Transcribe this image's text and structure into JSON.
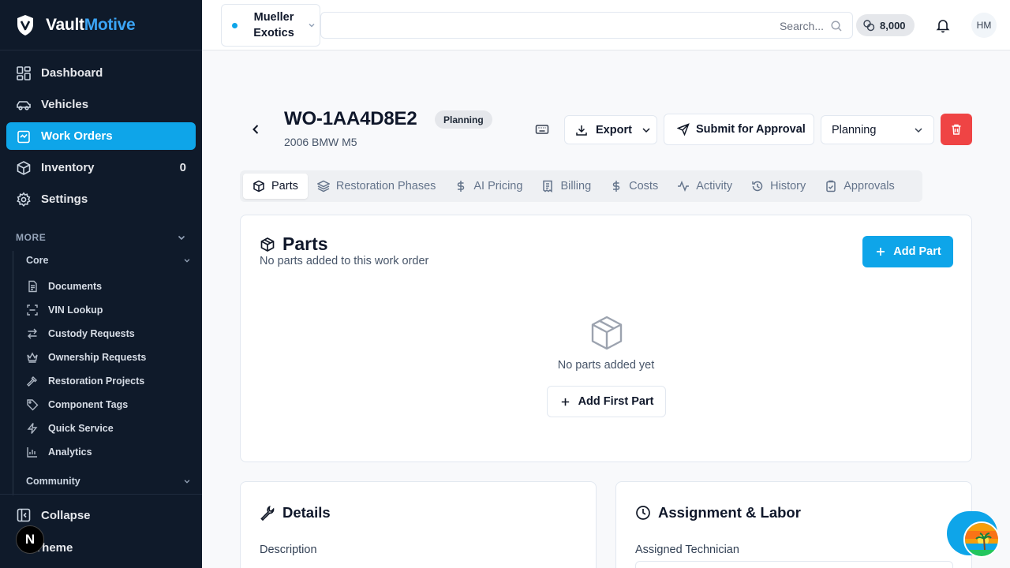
{
  "brand": {
    "name_part1": "Vault",
    "name_part2": "Motive"
  },
  "sidebar": {
    "nav": [
      {
        "label": "Dashboard",
        "icon": "dashboard-icon"
      },
      {
        "label": "Vehicles",
        "icon": "car-icon"
      },
      {
        "label": "Work Orders",
        "icon": "clipboard-icon",
        "active": true
      },
      {
        "label": "Inventory",
        "icon": "box-icon",
        "count": "0"
      },
      {
        "label": "Settings",
        "icon": "gear-icon"
      }
    ],
    "more_label": "MORE",
    "core_label": "Core",
    "core_items": [
      {
        "label": "Documents",
        "icon": "document-icon"
      },
      {
        "label": "VIN Lookup",
        "icon": "scan-icon"
      },
      {
        "label": "Custody Requests",
        "icon": "arrows-swap-icon"
      },
      {
        "label": "Ownership Requests",
        "icon": "crown-icon"
      },
      {
        "label": "Restoration Projects",
        "icon": "hammer-icon"
      },
      {
        "label": "Component Tags",
        "icon": "tag-icon"
      },
      {
        "label": "Quick Service",
        "icon": "lightning-icon"
      },
      {
        "label": "Analytics",
        "icon": "bar-chart-icon"
      }
    ],
    "community_label": "Community",
    "collapse_label": "Collapse",
    "theme_label": "Theme"
  },
  "topbar": {
    "shop_name": "Mueller Exotics",
    "search_placeholder": "Search...",
    "credits": "8,000",
    "avatar_initials": "HM"
  },
  "work_order": {
    "id": "WO-1AA4D8E2",
    "status_badge": "Planning",
    "vehicle": "2006 BMW M5",
    "export_label": "Export",
    "submit_label": "Submit for Approval",
    "status_value": "Planning"
  },
  "tabs": [
    {
      "label": "Parts",
      "icon": "box-icon",
      "active": true
    },
    {
      "label": "Restoration Phases",
      "icon": "layers-icon"
    },
    {
      "label": "AI Pricing",
      "icon": "dollar-icon"
    },
    {
      "label": "Billing",
      "icon": "receipt-icon"
    },
    {
      "label": "Costs",
      "icon": "dollar-icon"
    },
    {
      "label": "Activity",
      "icon": "activity-icon"
    },
    {
      "label": "History",
      "icon": "history-icon"
    },
    {
      "label": "Approvals",
      "icon": "clipboard-check-icon"
    }
  ],
  "parts": {
    "title": "Parts",
    "description": "No parts added to this work order",
    "add_label": "Add Part",
    "empty_text": "No parts added yet",
    "add_first_label": "Add First Part"
  },
  "details": {
    "title": "Details",
    "description_label": "Description"
  },
  "assignment": {
    "title": "Assignment & Labor",
    "technician_label": "Assigned Technician"
  },
  "next_badge": "N",
  "colors": {
    "accent": "#0ea5e9",
    "sidebar_bg": "#0f1a2a",
    "danger": "#ef4444"
  }
}
